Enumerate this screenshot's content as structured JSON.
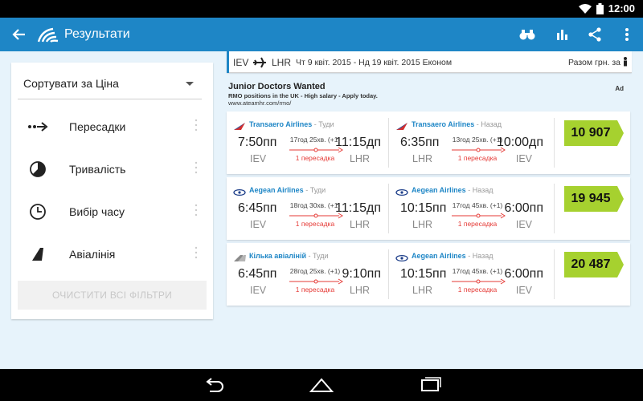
{
  "status": {
    "time": "12:00"
  },
  "appbar": {
    "title": "Результати",
    "actions": [
      "binoculars-icon",
      "bar-chart-icon",
      "share-icon",
      "more-vert-icon"
    ]
  },
  "filters": {
    "sort_label": "Сортувати за Ціна",
    "items": [
      {
        "label": "Пересадки",
        "icon": "stops-icon"
      },
      {
        "label": "Тривалість",
        "icon": "duration-icon"
      },
      {
        "label": "Вибір часу",
        "icon": "clock-icon"
      },
      {
        "label": "Авіалінія",
        "icon": "airline-tail-icon"
      }
    ],
    "clear_label": "ОЧИСТИТИ ВСІ ФІЛЬТРИ"
  },
  "search": {
    "origin": "IEV",
    "destination": "LHR",
    "dates": "Чт 9 квіт. 2015 - Нд 19 квіт. 2015  Економ",
    "total_label": "Разом грн. за"
  },
  "ad": {
    "headline": "Junior Doctors Wanted",
    "desc": "RMO positions in the UK - High salary - Apply today.",
    "url": "www.ateamhr.com/rmo/",
    "tag": "Ad"
  },
  "results": [
    {
      "price": "10 907",
      "out": {
        "airline": "Transaero Airlines",
        "dir": " - Туди",
        "dep_time": "7:50пп",
        "arr_time": "11:15дп",
        "dep": "IEV",
        "arr": "LHR",
        "duration": "17год 25хв. (+1)",
        "stops": "1 пересадка",
        "logo": "transaero"
      },
      "ret": {
        "airline": "Transaero Airlines",
        "dir": " - Назад",
        "dep_time": "6:35пп",
        "arr_time": "10:00дп",
        "dep": "LHR",
        "arr": "IEV",
        "duration": "13год 25хв. (+1)",
        "stops": "1 пересадка",
        "logo": "transaero"
      }
    },
    {
      "price": "19 945",
      "out": {
        "airline": "Aegean Airlines",
        "dir": " - Туди",
        "dep_time": "6:45пп",
        "arr_time": "11:15дп",
        "dep": "IEV",
        "arr": "LHR",
        "duration": "18год 30хв. (+1)",
        "stops": "1 пересадка",
        "logo": "aegean"
      },
      "ret": {
        "airline": "Aegean Airlines",
        "dir": " - Назад",
        "dep_time": "10:15пп",
        "arr_time": "6:00пп",
        "dep": "LHR",
        "arr": "IEV",
        "duration": "17год 45хв. (+1)",
        "stops": "1 пересадка",
        "logo": "aegean"
      }
    },
    {
      "price": "20 487",
      "out": {
        "airline": "Кілька авіаліній",
        "dir": " - Туди",
        "dep_time": "6:45пп",
        "arr_time": "9:10пп",
        "dep": "IEV",
        "arr": "LHR",
        "duration": "28год 25хв. (+1)",
        "stops": "1 пересадка",
        "logo": "multi"
      },
      "ret": {
        "airline": "Aegean Airlines",
        "dir": " - Назад",
        "dep_time": "10:15пп",
        "arr_time": "6:00пп",
        "dep": "LHR",
        "arr": "IEV",
        "duration": "17год 45хв. (+1)",
        "stops": "1 пересадка",
        "logo": "aegean"
      }
    }
  ],
  "colors": {
    "appbar": "#1e86c6",
    "price_badge": "#a6d12f",
    "stops_red": "#e53935",
    "background": "#e7f3fb"
  }
}
